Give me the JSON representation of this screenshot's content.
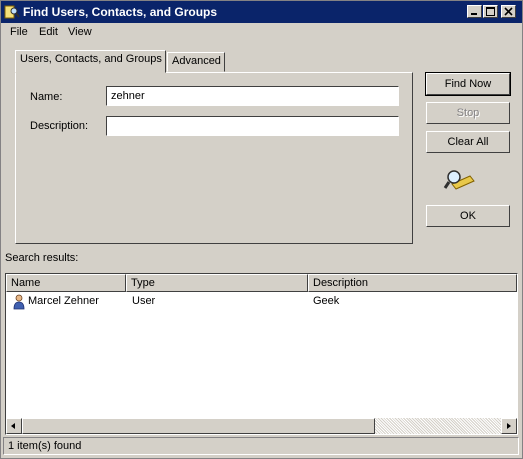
{
  "window": {
    "title": "Find Users, Contacts, and Groups"
  },
  "menu": {
    "items": [
      "File",
      "Edit",
      "View"
    ]
  },
  "tabs": [
    {
      "label": "Users, Contacts, and Groups",
      "active": true
    },
    {
      "label": "Advanced",
      "active": false
    }
  ],
  "form": {
    "name_label": "Name:",
    "name_value": "zehner",
    "description_label": "Description:",
    "description_value": ""
  },
  "buttons": {
    "find_now": "Find Now",
    "stop": "Stop",
    "clear_all": "Clear All",
    "ok": "OK"
  },
  "results": {
    "label": "Search results:",
    "columns": [
      "Name",
      "Type",
      "Description"
    ],
    "rows": [
      {
        "name": "Marcel Zehner",
        "type": "User",
        "description": "Geek"
      }
    ]
  },
  "status": {
    "text": "1 item(s) found"
  },
  "colors": {
    "titlebar": "#0a246a",
    "face": "#d4d0c8"
  }
}
